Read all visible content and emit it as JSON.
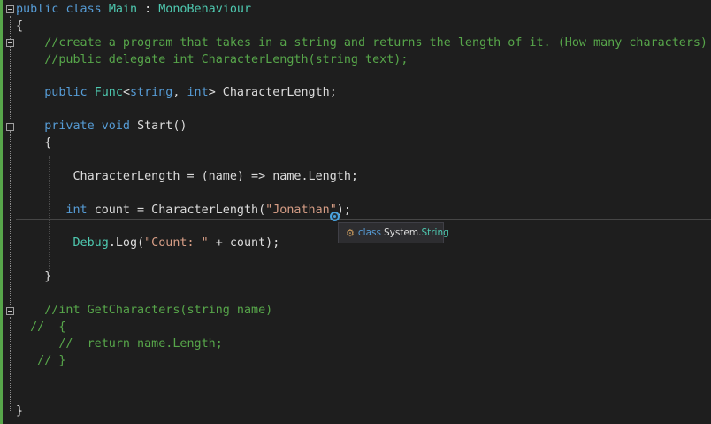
{
  "editor": {
    "lines": [
      {
        "id": "l1",
        "parts": [
          [
            "kw",
            "public"
          ],
          [
            "plain",
            " "
          ],
          [
            "kw",
            "class"
          ],
          [
            "plain",
            " "
          ],
          [
            "type",
            "Main"
          ],
          [
            "plain",
            " : "
          ],
          [
            "type",
            "MonoBehaviour"
          ]
        ]
      },
      {
        "id": "l2",
        "parts": [
          [
            "plain",
            "{"
          ]
        ]
      },
      {
        "id": "l3",
        "parts": [
          [
            "cmt",
            "    //create a program that takes in a string and returns the length of it. (How many characters)"
          ]
        ]
      },
      {
        "id": "l4",
        "parts": [
          [
            "cmt",
            "    //public delegate int CharacterLength(string text);"
          ]
        ]
      },
      {
        "id": "l5",
        "parts": [
          [
            "kw",
            "    public "
          ],
          [
            "type",
            "Func"
          ],
          [
            "plain",
            "<"
          ],
          [
            "kw",
            "string"
          ],
          [
            "plain",
            ", "
          ],
          [
            "kw",
            "int"
          ],
          [
            "plain",
            "> CharacterLength;"
          ]
        ]
      },
      {
        "id": "l6",
        "parts": [
          [
            "kw",
            "    private "
          ],
          [
            "kw",
            "void "
          ],
          [
            "plain",
            "Start()"
          ]
        ]
      },
      {
        "id": "l7",
        "parts": [
          [
            "plain",
            "    {"
          ]
        ]
      },
      {
        "id": "l8",
        "parts": [
          [
            "plain",
            "        CharacterLength = (name) => name.Length;"
          ]
        ]
      },
      {
        "id": "l9",
        "parts": [
          [
            "kw",
            "       int "
          ],
          [
            "plain",
            "count = CharacterLength("
          ],
          [
            "str",
            "\"Jonathan\""
          ],
          [
            "plain",
            ");"
          ]
        ]
      },
      {
        "id": "l10",
        "parts": [
          [
            "plain",
            "        "
          ],
          [
            "type",
            "Debug"
          ],
          [
            "plain",
            ".Log("
          ],
          [
            "str",
            "\"Count: \""
          ],
          [
            "plain",
            " + count);"
          ]
        ]
      },
      {
        "id": "l11",
        "parts": [
          [
            "plain",
            "    }"
          ]
        ]
      },
      {
        "id": "l12",
        "parts": [
          [
            "cmt",
            "    //int GetCharacters(string name)"
          ]
        ]
      },
      {
        "id": "l13",
        "parts": [
          [
            "cmt",
            "  //  {"
          ]
        ]
      },
      {
        "id": "l14",
        "parts": [
          [
            "cmt",
            "      //  return name.Length;"
          ]
        ]
      },
      {
        "id": "l15",
        "parts": [
          [
            "cmt",
            "   // }"
          ]
        ]
      },
      {
        "id": "l16",
        "parts": [
          [
            "plain",
            "}"
          ]
        ]
      }
    ]
  },
  "tooltip": {
    "icon": "class-icon",
    "keyword": "class",
    "namespace": "System.",
    "type": "String"
  }
}
